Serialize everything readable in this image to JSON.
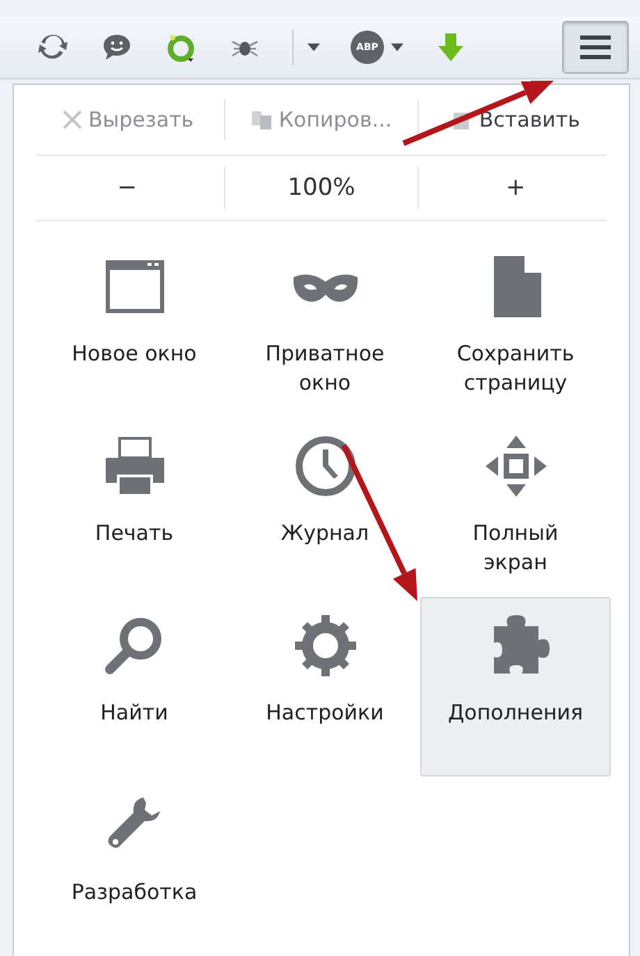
{
  "toolbar": {
    "items": [
      {
        "kind": "sync"
      },
      {
        "kind": "chat"
      },
      {
        "kind": "ring"
      },
      {
        "kind": "bug"
      },
      {
        "kind": "caret"
      },
      {
        "kind": "abp",
        "label": "ABP"
      },
      {
        "kind": "download"
      }
    ],
    "menu_button": {
      "pressed": true
    }
  },
  "edit_row": [
    {
      "kind": "cut",
      "label": "Вырезать",
      "disabled": true
    },
    {
      "kind": "copy",
      "label": "Копиров...",
      "disabled": true
    },
    {
      "kind": "paste",
      "label": "Вставить",
      "disabled": false
    }
  ],
  "zoom_row": {
    "minus": "−",
    "value": "100%",
    "plus": "+"
  },
  "grid": [
    {
      "kind": "window",
      "label": "Новое окно",
      "selected": false
    },
    {
      "kind": "mask",
      "label": "Приватное окно",
      "selected": false
    },
    {
      "kind": "page",
      "label": "Сохранить страницу",
      "selected": false
    },
    {
      "kind": "printer",
      "label": "Печать",
      "selected": false
    },
    {
      "kind": "clock",
      "label": "Журнал",
      "selected": false
    },
    {
      "kind": "fullscreen",
      "label": "Полный экран",
      "selected": false
    },
    {
      "kind": "search",
      "label": "Найти",
      "selected": false
    },
    {
      "kind": "gear",
      "label": "Настройки",
      "selected": false
    },
    {
      "kind": "puzzle",
      "label": "Дополнения",
      "selected": true
    },
    {
      "kind": "wrench",
      "label": "Разработка",
      "selected": false
    }
  ],
  "annotations": [
    {
      "kind": "arrow"
    },
    {
      "kind": "arrow"
    }
  ]
}
